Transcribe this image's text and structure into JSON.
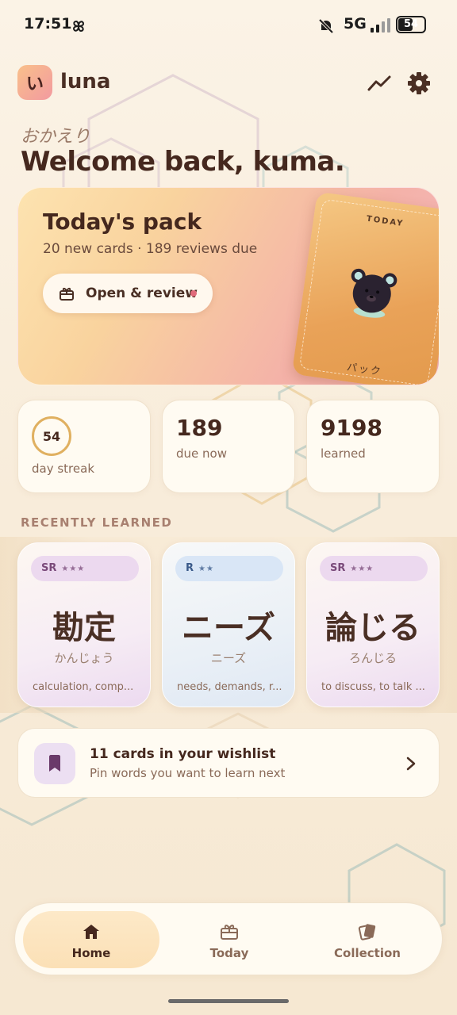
{
  "status_bar": {
    "time": "17:51",
    "network": "5G",
    "battery": "54",
    "icons": [
      "pinwheel-icon",
      "mute-icon",
      "signal-icon",
      "battery-icon"
    ]
  },
  "header": {
    "logo_char": "い",
    "app_name": "luna",
    "icons": [
      "trend-icon",
      "gear-icon"
    ]
  },
  "greeting": {
    "sub": "おかえり",
    "title": "Welcome back, kuma."
  },
  "today_pack": {
    "title": "Today's pack",
    "subtitle": "20 new cards · 189 reviews due",
    "button_label": "Open & review",
    "card_top": "TODAY",
    "card_bottom": "パック"
  },
  "stats": {
    "streak_value": "54",
    "streak_label": "day streak",
    "due_value": "189",
    "due_label": "due now",
    "learned_value": "9198",
    "learned_label": "learned"
  },
  "recent": {
    "section_label": "RECENTLY LEARNED",
    "cards": [
      {
        "rarity": "SR",
        "stars": "★★★",
        "kanji": "勘定",
        "reading": "かんじょう",
        "meaning": "calculation, comp..."
      },
      {
        "rarity": "R",
        "stars": "★★",
        "kanji": "ニーズ",
        "reading": "ニーズ",
        "meaning": "needs, demands, r..."
      },
      {
        "rarity": "SR",
        "stars": "★★★",
        "kanji": "論じる",
        "reading": "ろんじる",
        "meaning": "to discuss, to talk ..."
      }
    ]
  },
  "wishlist": {
    "title": "11 cards in your wishlist",
    "subtitle": "Pin words you want to learn next"
  },
  "nav": {
    "items": [
      {
        "label": "Home",
        "icon": "home-icon",
        "active": true
      },
      {
        "label": "Today",
        "icon": "gift-icon",
        "active": false
      },
      {
        "label": "Collection",
        "icon": "cards-icon",
        "active": false
      }
    ]
  },
  "colors": {
    "background": "#fbf3e6",
    "accent": "#e0b060",
    "pack_gradient_start": "#fde3b0",
    "pack_gradient_end": "#f5b6bc",
    "sr_pill": "#ecd9ef",
    "r_pill": "#d9e6f6"
  }
}
